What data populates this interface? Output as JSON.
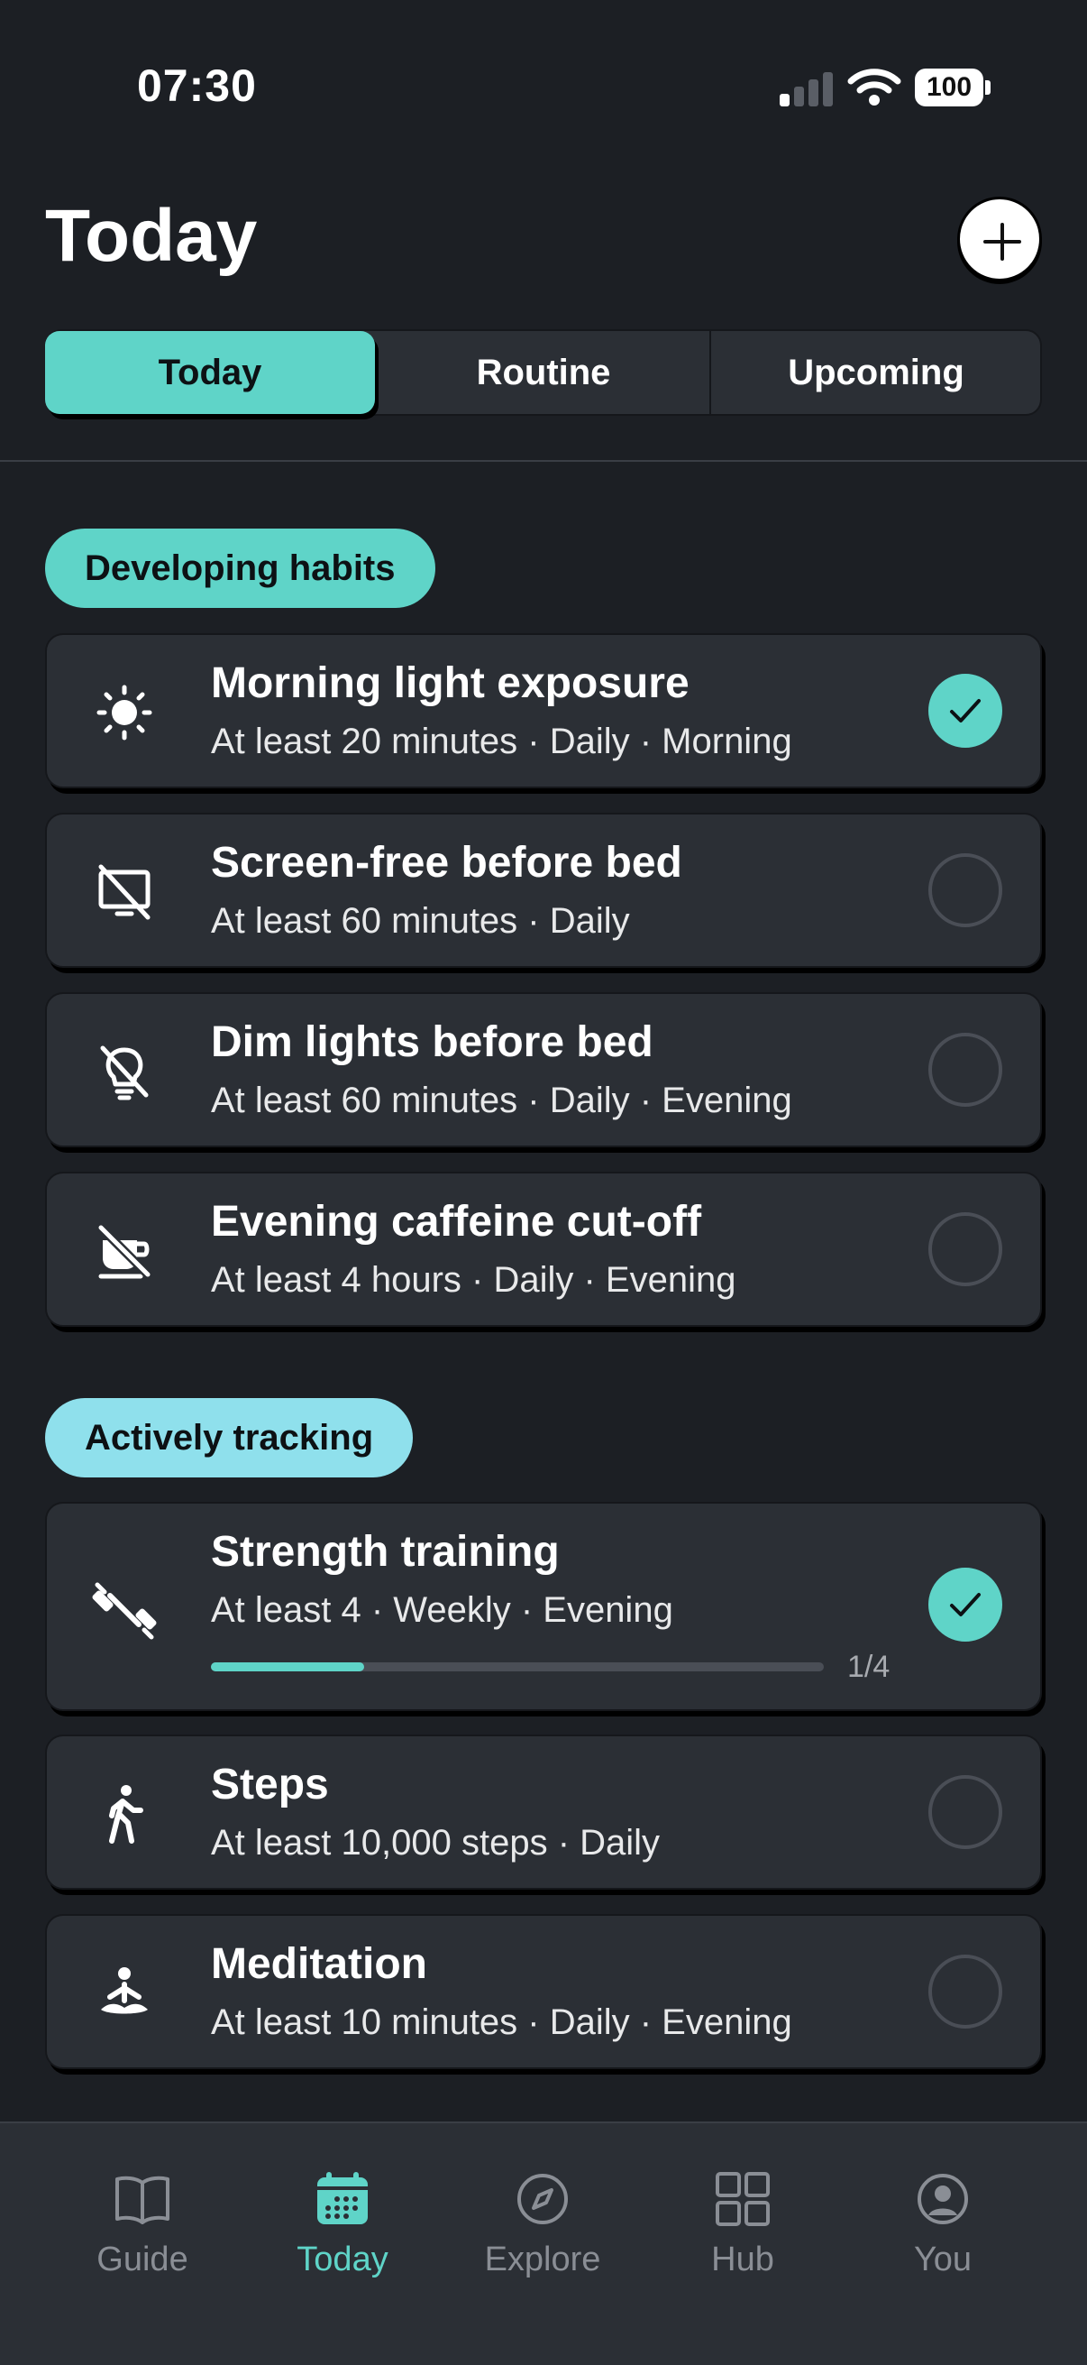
{
  "status": {
    "time": "07:30",
    "battery": "100"
  },
  "header": {
    "title": "Today",
    "add_icon": "plus-icon"
  },
  "tabs": [
    {
      "label": "Today",
      "active": true
    },
    {
      "label": "Routine",
      "active": false
    },
    {
      "label": "Upcoming",
      "active": false
    }
  ],
  "sections": {
    "developing": {
      "label": "Developing habits",
      "items": [
        {
          "title": "Morning light exposure",
          "subtitle": "At least 20 minutes · Daily · Morning",
          "icon": "sun-icon",
          "done": true
        },
        {
          "title": "Screen-free before bed",
          "subtitle": "At least 60 minutes · Daily",
          "icon": "screen-off-icon",
          "done": false
        },
        {
          "title": "Dim lights before bed",
          "subtitle": "At least 60 minutes · Daily · Evening",
          "icon": "bulb-off-icon",
          "done": false
        },
        {
          "title": "Evening caffeine cut-off",
          "subtitle": "At least 4 hours · Daily · Evening",
          "icon": "no-coffee-icon",
          "done": false
        }
      ]
    },
    "tracking": {
      "label": "Actively tracking",
      "items": [
        {
          "title": "Strength training",
          "subtitle": "At least 4 · Weekly · Evening",
          "icon": "dumbbell-icon",
          "done": true,
          "progress_label": "1/4",
          "progress": 0.25
        },
        {
          "title": "Steps",
          "subtitle": "At least 10,000 steps · Daily",
          "icon": "walking-icon",
          "done": false
        },
        {
          "title": "Meditation",
          "subtitle": "At least 10 minutes · Daily · Evening",
          "icon": "meditation-icon",
          "done": false
        }
      ]
    }
  },
  "nav": [
    {
      "label": "Guide",
      "icon": "book-icon",
      "active": false
    },
    {
      "label": "Today",
      "icon": "calendar-icon",
      "active": true
    },
    {
      "label": "Explore",
      "icon": "compass-icon",
      "active": false
    },
    {
      "label": "Hub",
      "icon": "grid-icon",
      "active": false
    },
    {
      "label": "You",
      "icon": "profile-icon",
      "active": false
    }
  ],
  "colors": {
    "accent": "#5fd4c8",
    "tracking_pill": "#8fe0ec",
    "background": "#1c1f24",
    "card": "#2b2f35"
  }
}
